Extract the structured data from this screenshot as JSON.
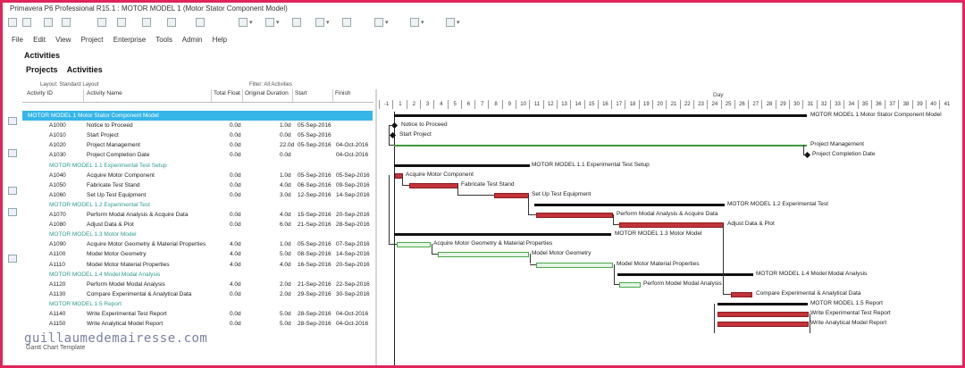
{
  "app": {
    "title": "Primavera P6 Professional R15.1 : MOTOR MODEL 1 (Motor Stator Component Model)"
  },
  "colors": {
    "frame": "#e0245c",
    "selected_row": "#36b6e8",
    "wbs_text": "#2e9c8e",
    "critical_bar": "#c3333a",
    "noncritical_bar": "#e4f5e4",
    "summary_bar": "#111111"
  },
  "menu": [
    "File",
    "Edit",
    "View",
    "Project",
    "Enterprise",
    "Tools",
    "Admin",
    "Help"
  ],
  "page_title": "Activities",
  "tabs": [
    "Projects",
    "Activities"
  ],
  "layout_label": "Layout: Standard Layout",
  "filter_label": "Filter: All Activities",
  "columns": [
    "Activity ID",
    "Activity Name",
    "Total Float",
    "Original Duration",
    "Start",
    "Finish"
  ],
  "timescale": {
    "label": "Day",
    "days": [
      "-1",
      "1",
      "2",
      "3",
      "4",
      "5",
      "6",
      "7",
      "8",
      "9",
      "10",
      "11",
      "12",
      "13",
      "14",
      "15",
      "16",
      "17",
      "18",
      "19",
      "20",
      "21",
      "22",
      "23",
      "24",
      "25",
      "26",
      "27",
      "28",
      "29",
      "30",
      "31",
      "32",
      "33",
      "34",
      "35",
      "36",
      "37",
      "38",
      "39",
      "40",
      "41"
    ]
  },
  "rows": [
    {
      "type": "top",
      "id": "MOTOR MODEL 1  Motor Stator Component Model",
      "name": "",
      "float": "",
      "dur": "",
      "start": "",
      "finish": ""
    },
    {
      "type": "task",
      "id": "A1000",
      "name": "Notice to Proceed",
      "float": "0.0d",
      "dur": "1.0d",
      "start": "05-Sep-2016",
      "finish": ""
    },
    {
      "type": "task",
      "id": "A1010",
      "name": "Start Project",
      "float": "0.0d",
      "dur": "0.0d",
      "start": "05-Sep-2016",
      "finish": ""
    },
    {
      "type": "task",
      "id": "A1020",
      "name": "Project Management",
      "float": "0.0d",
      "dur": "22.0d",
      "start": "05-Sep-2016",
      "finish": "04-Oct-2016"
    },
    {
      "type": "task",
      "id": "A1030",
      "name": "Project Completion Date",
      "float": "0.0d",
      "dur": "0.0d",
      "start": "",
      "finish": "04-Oct-2016"
    },
    {
      "type": "wbs",
      "id": "MOTOR MODEL 1.1  Experimental Test Setup",
      "name": "",
      "float": "",
      "dur": "",
      "start": "",
      "finish": ""
    },
    {
      "type": "task",
      "id": "A1040",
      "name": "Acquire Motor Component",
      "float": "0.0d",
      "dur": "1.0d",
      "start": "05-Sep-2016",
      "finish": "05-Sep-2016"
    },
    {
      "type": "task",
      "id": "A1050",
      "name": "Fabricate Test Stand",
      "float": "0.0d",
      "dur": "4.0d",
      "start": "06-Sep-2016",
      "finish": "09-Sep-2016"
    },
    {
      "type": "task",
      "id": "A1060",
      "name": "Set Up Test Equipment",
      "float": "0.0d",
      "dur": "3.0d",
      "start": "12-Sep-2016",
      "finish": "14-Sep-2016"
    },
    {
      "type": "wbs",
      "id": "MOTOR MODEL 1.2  Experimental Test",
      "name": "",
      "float": "",
      "dur": "",
      "start": "",
      "finish": ""
    },
    {
      "type": "task",
      "id": "A1070",
      "name": "Perform Modal Analysis & Acquire Data",
      "float": "0.0d",
      "dur": "4.0d",
      "start": "15-Sep-2016",
      "finish": "20-Sep-2016"
    },
    {
      "type": "task",
      "id": "A1080",
      "name": "Adjust Data & Plot",
      "float": "0.0d",
      "dur": "6.0d",
      "start": "21-Sep-2016",
      "finish": "28-Sep-2016"
    },
    {
      "type": "wbs",
      "id": "MOTOR MODEL 1.3  Motor Model",
      "name": "",
      "float": "",
      "dur": "",
      "start": "",
      "finish": ""
    },
    {
      "type": "task",
      "id": "A1090",
      "name": "Acquire Motor Geometry & Material Properties",
      "float": "4.0d",
      "dur": "1.0d",
      "start": "05-Sep-2016",
      "finish": "07-Sep-2016"
    },
    {
      "type": "task",
      "id": "A1100",
      "name": "Model Motor Geometry",
      "float": "4.0d",
      "dur": "5.0d",
      "start": "08-Sep-2016",
      "finish": "14-Sep-2016"
    },
    {
      "type": "task",
      "id": "A1110",
      "name": "Model Motor Material Properties",
      "float": "4.0d",
      "dur": "4.0d",
      "start": "16-Sep-2016",
      "finish": "20-Sep-2016"
    },
    {
      "type": "wbs",
      "id": "MOTOR MODEL 1.4  Model Modal Analysis",
      "name": "",
      "float": "",
      "dur": "",
      "start": "",
      "finish": ""
    },
    {
      "type": "task",
      "id": "A1120",
      "name": "Perform Model Modal Analysis",
      "float": "4.0d",
      "dur": "2.0d",
      "start": "21-Sep-2016",
      "finish": "22-Sep-2016"
    },
    {
      "type": "task",
      "id": "A1130",
      "name": "Compare Experimental & Analytical Data",
      "float": "0.0d",
      "dur": "2.0d",
      "start": "29-Sep-2016",
      "finish": "30-Sep-2016"
    },
    {
      "type": "wbs",
      "id": "MOTOR MODEL 1.5  Report",
      "name": "",
      "float": "",
      "dur": "",
      "start": "",
      "finish": ""
    },
    {
      "type": "task",
      "id": "A1140",
      "name": "Write Experimental Test Report",
      "float": "0.0d",
      "dur": "5.0d",
      "start": "28-Sep-2016",
      "finish": "04-Oct-2016"
    },
    {
      "type": "task",
      "id": "A1150",
      "name": "Write Analytical Model Report",
      "float": "0.0d",
      "dur": "5.0d",
      "start": "28-Sep-2016",
      "finish": "04-Oct-2016"
    }
  ],
  "gantt_labels": [
    "MOTOR MODEL 1  Motor Stator Component Model",
    "Notice to Proceed",
    "Start Project",
    "Project Management",
    "Project Completion Date",
    "MOTOR MODEL 1.1  Experimental Test Setup",
    "Acquire Motor Component",
    "Fabricate Test Stand",
    "Set Up Test Equipment",
    "MOTOR MODEL 1.2  Experimental Test",
    "Perform Modal Analysis & Acquire Data",
    "Adjust Data & Plot",
    "MOTOR MODEL 1.3  Motor Model",
    "Acquire Motor Geometry & Material Properties",
    "Model Motor Geometry",
    "Model Motor Material Properties",
    "MOTOR MODEL 1.4  Model Modal Analysis",
    "Perform Model Modal Analysis",
    "Compare Experimental & Analytical Data",
    "MOTOR MODEL 1.5  Report",
    "Write Experimental Test Report",
    "Write Analytical Model Report"
  ],
  "watermark": "guillaumedemairesse.com",
  "watermark_sub": "Gantt Chart Template"
}
